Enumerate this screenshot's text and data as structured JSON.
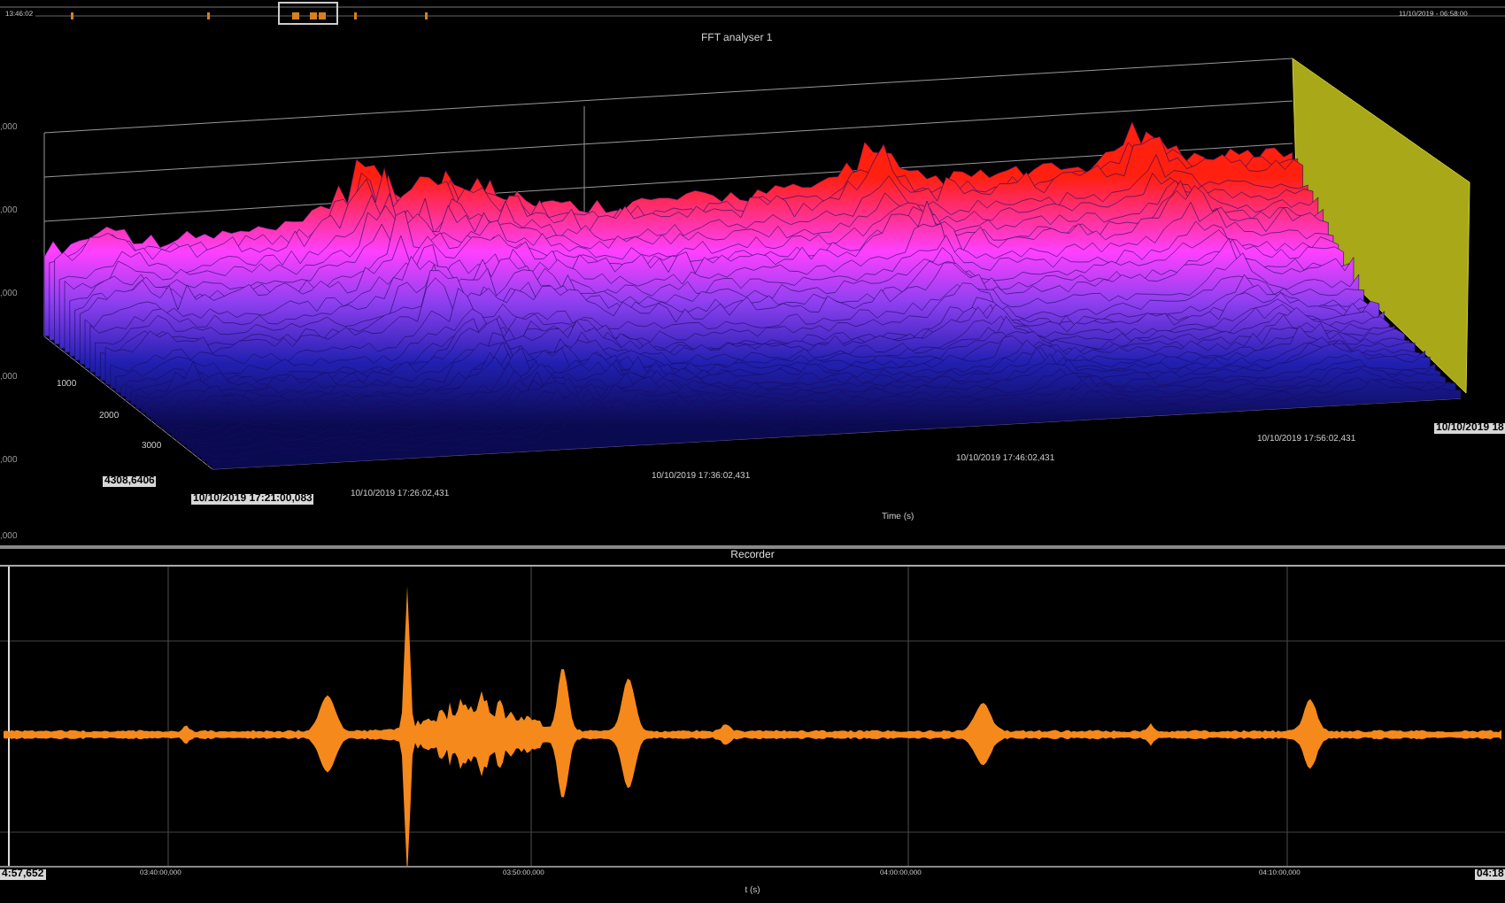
{
  "overview": {
    "start_label": "13:46:02",
    "end_label": "11/10/2019 - 06:58:00"
  },
  "fft": {
    "title": "FFT analyser 1",
    "value_labels": [
      ",000",
      ",000",
      ",000",
      ",000",
      ",000",
      ",000"
    ],
    "frequency_labels": [
      "1000",
      "2000",
      "3000"
    ],
    "frequency_max": "4308,6406",
    "time_start": "10/10/2019 17:21:00,083",
    "time_labels": [
      "10/10/2019 17:26:02,431",
      "10/10/2019 17:36:02,431",
      "10/10/2019 17:46:02,431",
      "10/10/2019 17:56:02,431"
    ],
    "time_end": "10/10/2019 18",
    "time_axis_title": "Time (s)"
  },
  "recorder": {
    "title": "Recorder",
    "start_label": "4:57,652",
    "tick_labels": [
      "03:40:00,000",
      "03:50:00,000",
      "04:00:00,000",
      "04:10:00,000"
    ],
    "end_label": "04:18",
    "axis_title": "t (s)"
  }
}
